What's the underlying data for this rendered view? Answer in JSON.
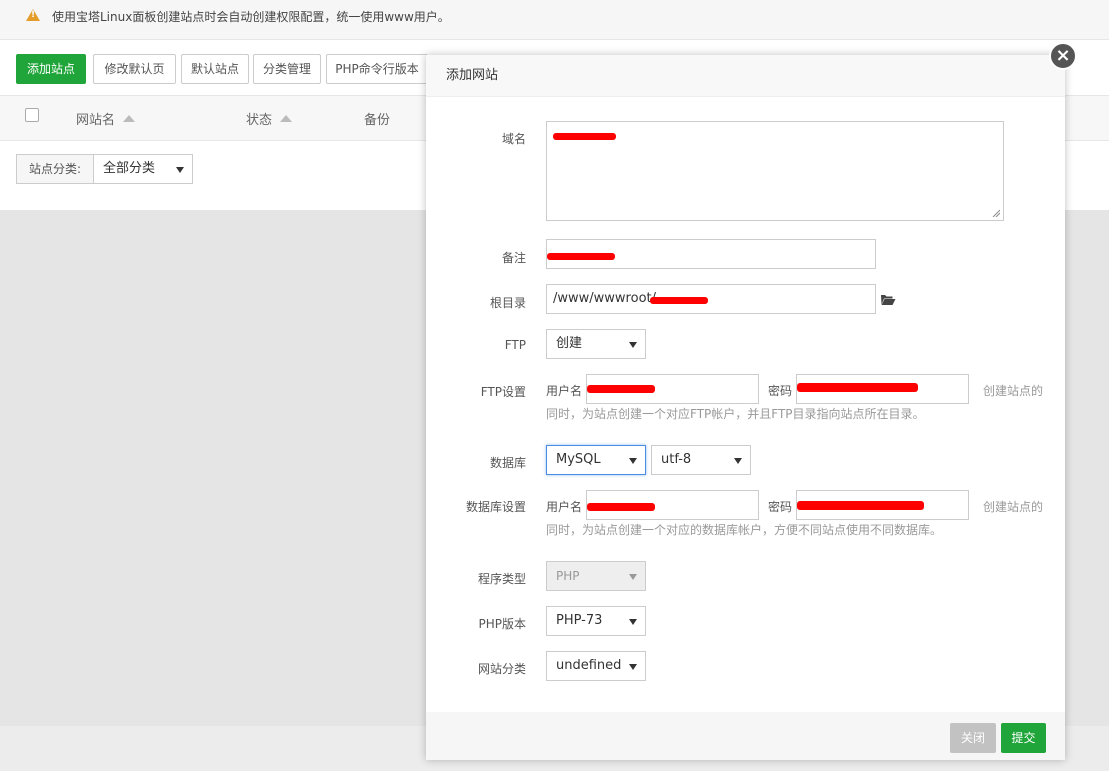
{
  "notice": {
    "text": "使用宝塔Linux面板创建站点时会自动创建权限配置，统一使用www用户。"
  },
  "toolbar": {
    "add_site": "添加站点",
    "modify_default_page": "修改默认页",
    "default_site": "默认站点",
    "category_manage": "分类管理",
    "php_cli_version": "PHP命令行版本"
  },
  "table": {
    "col_name": "网站名",
    "col_status": "状态",
    "col_backup": "备份"
  },
  "category_filter": {
    "label": "站点分类:",
    "value": "全部分类"
  },
  "modal": {
    "title": "添加网站",
    "domain_label": "域名",
    "remark_label": "备注",
    "root_label": "根目录",
    "root_value": "/www/wwwroot/",
    "ftp_label": "FTP",
    "ftp_value": "创建",
    "ftp_settings_label": "FTP设置",
    "ftp_user_label": "用户名",
    "ftp_pass_label": "密码",
    "ftp_hint_right": "创建站点的",
    "ftp_hint_line2": "同时，为站点创建一个对应FTP帐户，并且FTP目录指向站点所在目录。",
    "db_label": "数据库",
    "db_value": "MySQL",
    "db_charset": "utf-8",
    "db_settings_label": "数据库设置",
    "db_user_label": "用户名",
    "db_pass_label": "密码",
    "db_hint_right": "创建站点的",
    "db_hint_line2": "同时，为站点创建一个对应的数据库帐户，方便不同站点使用不同数据库。",
    "program_type_label": "程序类型",
    "program_type_value": "PHP",
    "php_version_label": "PHP版本",
    "php_version_value": "PHP-73",
    "site_category_label": "网站分类",
    "site_category_value": "undefined",
    "close_button": "关闭",
    "submit_button": "提交",
    "close_x": "×"
  },
  "colors": {
    "brand_green": "#20a53a",
    "redaction": "#ff0000",
    "focus_blue": "#4b8fe3"
  },
  "icons": [
    "warning-icon",
    "sort-asc-icon",
    "folder-open-icon",
    "close-icon",
    "caret-down-icon"
  ]
}
